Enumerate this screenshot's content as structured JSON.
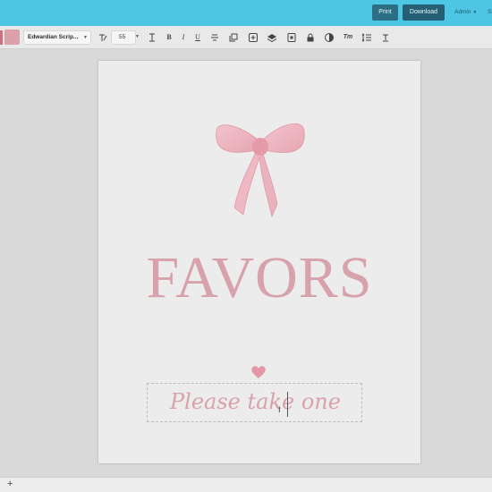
{
  "header": {
    "print_label": "Print",
    "download_label": "Download",
    "user_label": "Admin",
    "trailing_label": "Sh"
  },
  "toolbar": {
    "colors": [
      "#cf6f7f",
      "#dca0a9"
    ],
    "font_name": "Edwardian Scrip...",
    "font_size": "55",
    "icons": [
      "text-effects-icon",
      "letter-spacing-icon",
      "bold-icon",
      "italic-icon",
      "underline-icon",
      "strikethrough-icon",
      "copy-style-icon",
      "add-icon",
      "layers-icon",
      "duplicate-icon",
      "lock-icon",
      "opacity-icon",
      "text-transform-icon",
      "line-height-icon",
      "clear-format-icon"
    ]
  },
  "canvas": {
    "title": "FAVORS",
    "tagline": "Please take one",
    "accent_color": "#d8a2ac"
  },
  "footer": {
    "add_symbol": "+"
  }
}
